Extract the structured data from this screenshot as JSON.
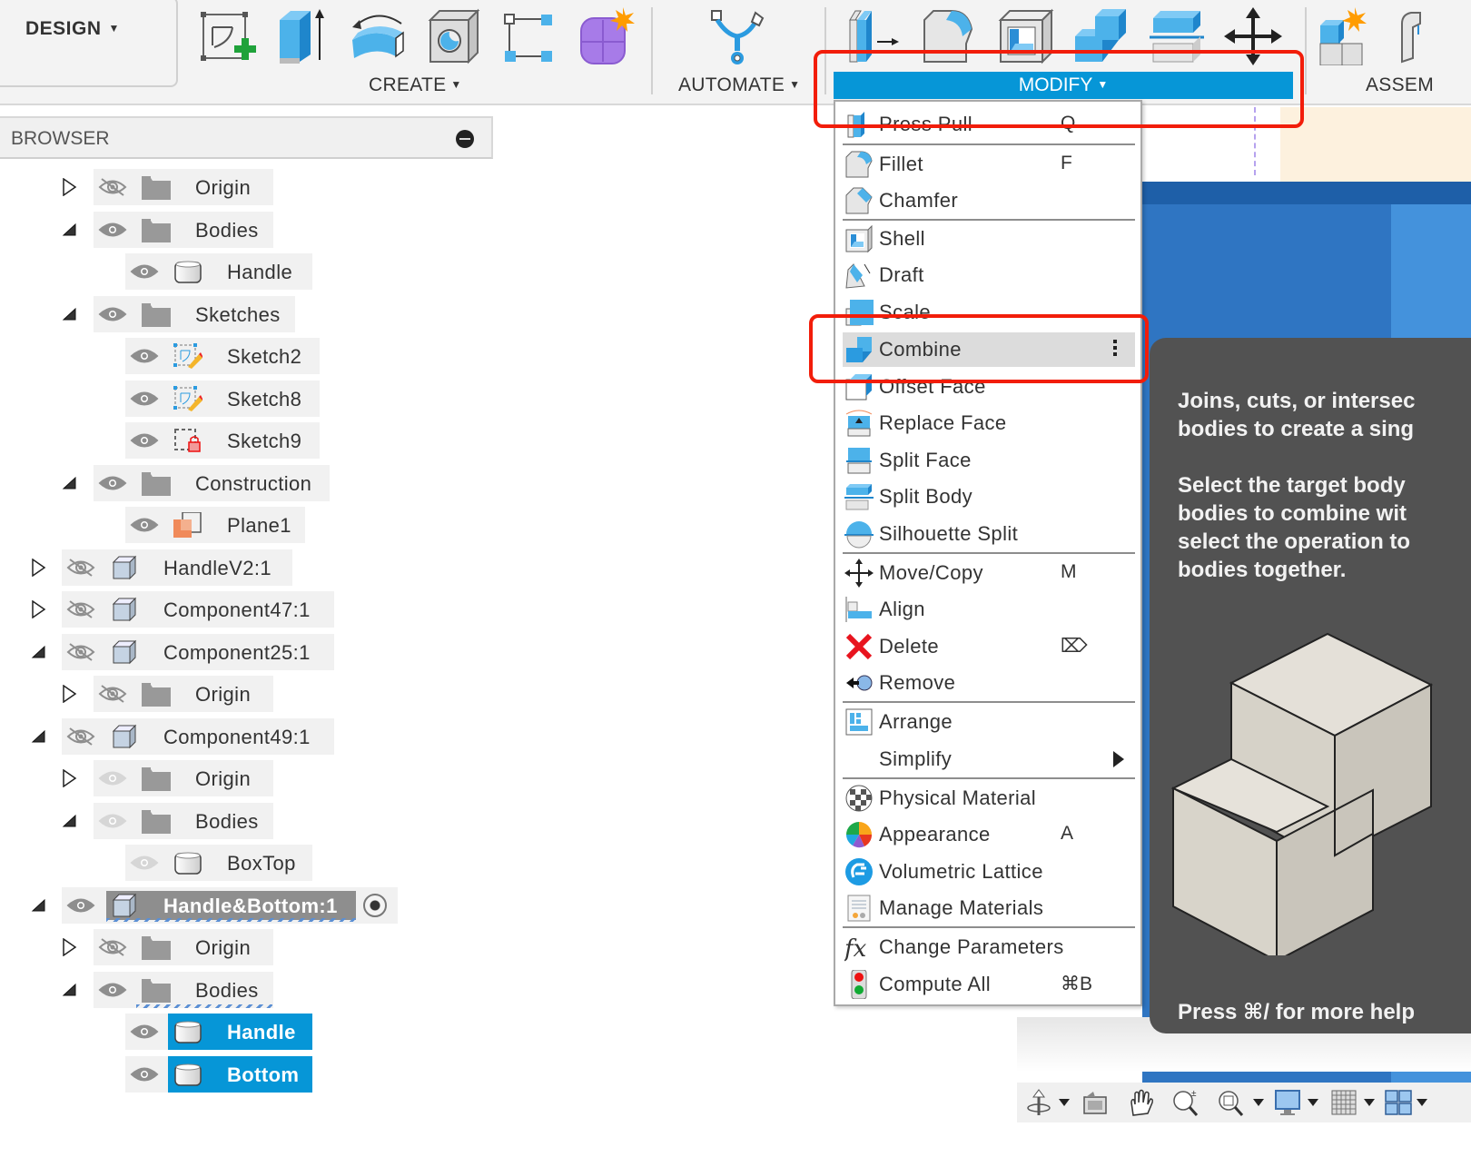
{
  "toolbar": {
    "workspace_label": "DESIGN",
    "groups": {
      "create": "CREATE",
      "automate": "AUTOMATE",
      "modify": "MODIFY",
      "assemble": "ASSEM"
    },
    "create_icons": [
      "create-sketch-icon",
      "extrude-icon",
      "revolve-icon",
      "hole-icon",
      "rectangular-pattern-icon",
      "create-form-icon"
    ],
    "automate_icons": [
      "automate-icon"
    ],
    "modify_icons": [
      "press-pull-icon",
      "fillet-icon",
      "shell-icon",
      "combine-icon",
      "split-body-icon",
      "move-copy-icon"
    ],
    "assemble_icons": [
      "new-component-icon",
      "joint-icon"
    ],
    "accent_color": "#0696d7"
  },
  "browser": {
    "title": "BROWSER",
    "rows": [
      {
        "label": "Origin",
        "toggle": "collapsed",
        "visibility": "hidden",
        "icon": "folder"
      },
      {
        "label": "Bodies",
        "toggle": "expanded",
        "visibility": "visible",
        "icon": "folder"
      },
      {
        "label": "Handle",
        "toggle": "none",
        "visibility": "visible",
        "icon": "body"
      },
      {
        "label": "Sketches",
        "toggle": "expanded",
        "visibility": "visible",
        "icon": "folder"
      },
      {
        "label": "Sketch2",
        "toggle": "none",
        "visibility": "visible",
        "icon": "sketch"
      },
      {
        "label": "Sketch8",
        "toggle": "none",
        "visibility": "visible",
        "icon": "sketch"
      },
      {
        "label": "Sketch9",
        "toggle": "none",
        "visibility": "visible",
        "icon": "sketch-locked"
      },
      {
        "label": "Construction",
        "toggle": "expanded",
        "visibility": "visible",
        "icon": "folder"
      },
      {
        "label": "Plane1",
        "toggle": "none",
        "visibility": "visible",
        "icon": "plane"
      },
      {
        "label": "HandleV2:1",
        "toggle": "collapsed",
        "visibility": "hidden",
        "icon": "component"
      },
      {
        "label": "Component47:1",
        "toggle": "collapsed",
        "visibility": "hidden",
        "icon": "component"
      },
      {
        "label": "Component25:1",
        "toggle": "expanded",
        "visibility": "hidden",
        "icon": "component"
      },
      {
        "label": "Origin",
        "toggle": "collapsed",
        "visibility": "hidden",
        "icon": "folder"
      },
      {
        "label": "Component49:1",
        "toggle": "expanded",
        "visibility": "hidden",
        "icon": "component"
      },
      {
        "label": "Origin",
        "toggle": "collapsed",
        "visibility": "dimmed",
        "icon": "folder"
      },
      {
        "label": "Bodies",
        "toggle": "expanded",
        "visibility": "dimmed",
        "icon": "folder"
      },
      {
        "label": "BoxTop",
        "toggle": "none",
        "visibility": "dimmed",
        "icon": "body"
      },
      {
        "label": "Handle&Bottom:1",
        "toggle": "expanded",
        "visibility": "visible",
        "icon": "component",
        "active": true
      },
      {
        "label": "Origin",
        "toggle": "collapsed",
        "visibility": "hidden",
        "icon": "folder"
      },
      {
        "label": "Bodies",
        "toggle": "expanded",
        "visibility": "visible",
        "icon": "folder"
      },
      {
        "label": "Handle",
        "toggle": "none",
        "visibility": "visible",
        "icon": "body",
        "selected": true
      },
      {
        "label": "Bottom",
        "toggle": "none",
        "visibility": "visible",
        "icon": "body",
        "selected": true
      }
    ]
  },
  "modify_menu": {
    "items": [
      {
        "label": "Press Pull",
        "shortcut": "Q",
        "icon": "press-pull-icon"
      },
      {
        "label": "Fillet",
        "shortcut": "F",
        "icon": "fillet-icon"
      },
      {
        "label": "Chamfer",
        "shortcut": "",
        "icon": "chamfer-icon"
      },
      {
        "label": "Shell",
        "shortcut": "",
        "icon": "shell-icon"
      },
      {
        "label": "Draft",
        "shortcut": "",
        "icon": "draft-icon"
      },
      {
        "label": "Scale",
        "shortcut": "",
        "icon": "scale-icon"
      },
      {
        "label": "Combine",
        "shortcut": "",
        "icon": "combine-icon",
        "highlighted": true
      },
      {
        "label": "Offset Face",
        "shortcut": "",
        "icon": "offset-face-icon"
      },
      {
        "label": "Replace Face",
        "shortcut": "",
        "icon": "replace-face-icon"
      },
      {
        "label": "Split Face",
        "shortcut": "",
        "icon": "split-face-icon"
      },
      {
        "label": "Split Body",
        "shortcut": "",
        "icon": "split-body-icon"
      },
      {
        "label": "Silhouette Split",
        "shortcut": "",
        "icon": "silhouette-split-icon"
      },
      {
        "label": "Move/Copy",
        "shortcut": "M",
        "icon": "move-copy-icon"
      },
      {
        "label": "Align",
        "shortcut": "",
        "icon": "align-icon"
      },
      {
        "label": "Delete",
        "shortcut": "⌦",
        "icon": "delete-icon"
      },
      {
        "label": "Remove",
        "shortcut": "",
        "icon": "remove-icon"
      },
      {
        "label": "Arrange",
        "shortcut": "",
        "icon": "arrange-icon"
      },
      {
        "label": "Simplify",
        "shortcut": "",
        "icon": "",
        "submenu": true
      },
      {
        "label": "Physical Material",
        "shortcut": "",
        "icon": "physical-material-icon"
      },
      {
        "label": "Appearance",
        "shortcut": "A",
        "icon": "appearance-icon"
      },
      {
        "label": "Volumetric Lattice",
        "shortcut": "",
        "icon": "volumetric-lattice-icon"
      },
      {
        "label": "Manage Materials",
        "shortcut": "",
        "icon": "manage-materials-icon"
      },
      {
        "label": "Change Parameters",
        "shortcut": "",
        "icon": "change-parameters-icon"
      },
      {
        "label": "Compute All",
        "shortcut": "⌘B",
        "icon": "compute-all-icon"
      }
    ]
  },
  "tooltip": {
    "description": "Joins, cuts, or intersec\nbodies to create a sing",
    "instructions": "Select the target body\nbodies to combine wit\nselect the operation to\nbodies together.",
    "help": "Press ⌘/ for more help"
  },
  "navbar": {
    "icons": [
      "orbit-icon",
      "look-at-icon",
      "pan-icon",
      "zoom-icon",
      "zoom-window-icon",
      "display-settings-icon",
      "grid-icon",
      "viewports-icon"
    ]
  }
}
